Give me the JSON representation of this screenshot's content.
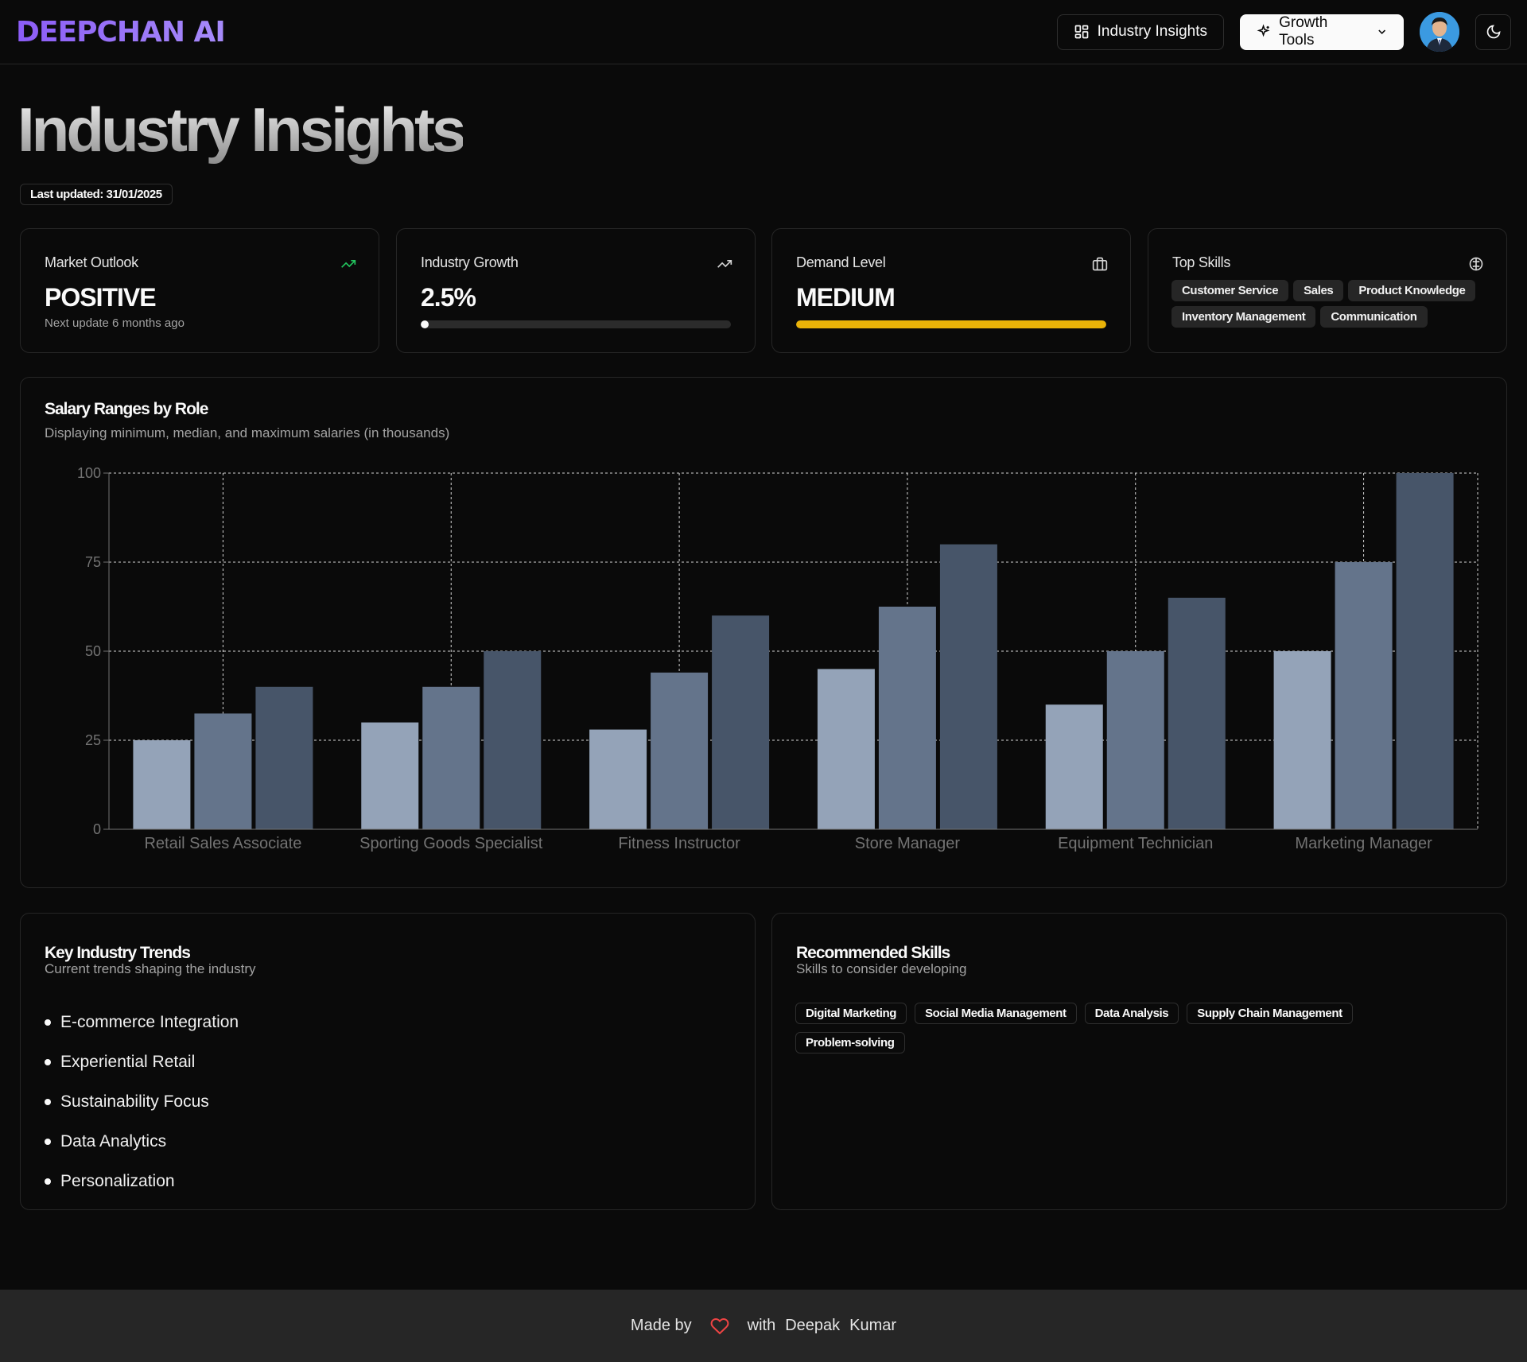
{
  "header": {
    "logo": "DEEPCHAN AI",
    "insights_button": "Industry Insights",
    "growth_button": "Growth Tools"
  },
  "page": {
    "title": "Industry Insights",
    "last_updated": "Last updated: 31/01/2025"
  },
  "stats": {
    "market_outlook": {
      "label": "Market Outlook",
      "value": "POSITIVE",
      "sub": "Next update 6 months ago",
      "icon": "trending-up-icon",
      "icon_color": "#22c55e"
    },
    "industry_growth": {
      "label": "Industry Growth",
      "value": "2.5%",
      "progress": 0.025,
      "icon": "trending-up-icon"
    },
    "demand_level": {
      "label": "Demand Level",
      "value": "MEDIUM",
      "progress": 1.0,
      "bar_color": "#eab308",
      "icon": "briefcase-icon"
    },
    "top_skills": {
      "label": "Top Skills",
      "icon": "brain-icon",
      "skills": [
        "Customer Service",
        "Sales",
        "Product Knowledge",
        "Inventory Management",
        "Communication"
      ]
    }
  },
  "salary_chart": {
    "title": "Salary Ranges by Role",
    "description": "Displaying minimum, median, and maximum salaries (in thousands)"
  },
  "chart_data": {
    "type": "bar",
    "categories": [
      "Retail Sales Associate",
      "Sporting Goods Specialist",
      "Fitness Instructor",
      "Store Manager",
      "Equipment Technician",
      "Marketing Manager"
    ],
    "series": [
      {
        "values": [
          25,
          30,
          28,
          45,
          35,
          50
        ],
        "color": "#94a3b8"
      },
      {
        "values": [
          32.5,
          40,
          44,
          62.5,
          50,
          75
        ],
        "color": "#64748b"
      },
      {
        "values": [
          40,
          50,
          60,
          80,
          65,
          100
        ],
        "color": "#475569"
      }
    ],
    "ylim": [
      0,
      100
    ],
    "yticks": [
      0,
      25,
      50,
      75,
      100
    ],
    "grid": true
  },
  "trends": {
    "title": "Key Industry Trends",
    "description": "Current trends shaping the industry",
    "items": [
      "E-commerce Integration",
      "Experiential Retail",
      "Sustainability Focus",
      "Data Analytics",
      "Personalization"
    ]
  },
  "recommended": {
    "title": "Recommended Skills",
    "description": "Skills to consider developing",
    "skills": [
      "Digital Marketing",
      "Social Media Management",
      "Data Analysis",
      "Supply Chain Management",
      "Problem-solving"
    ]
  },
  "footer": {
    "made_by": "Made by",
    "with": "with",
    "first_name": "Deepak",
    "last_name": "Kumar",
    "heart_color": "#ef4444"
  }
}
